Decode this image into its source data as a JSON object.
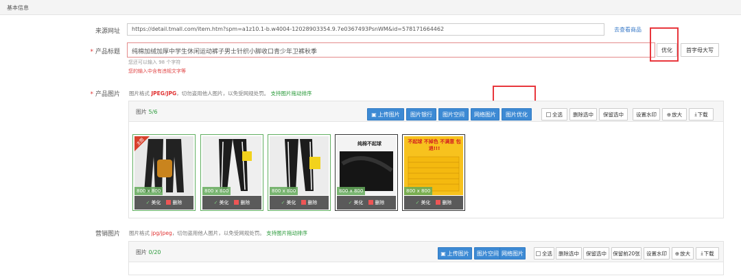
{
  "section": {
    "title": "基本信息"
  },
  "source": {
    "label": "来源网址",
    "url": "https://detail.tmall.com/item.htm?spm=a1z10.1-b.w4004-12028903354.9.7e0367493PsnWM&id=578171664462",
    "view_link": "去查看商品"
  },
  "product_title": {
    "label": "产品标题",
    "required": "*",
    "value": "纯棉加绒加厚中学生休闲运动裤子男士针织小脚收口青少年卫裤秋季",
    "hint_count": "您还可以输入 98 个字符",
    "hint_red": "您的输入中含有违规文字等",
    "optimize_button": "优化",
    "capitalize_button": "首字母大写"
  },
  "product_images": {
    "label": "产品图片",
    "required": "*",
    "format_prefix": "图片格式",
    "format_types": "JPEG/JPG",
    "format_suffix": "，切勿盗用他人图片，以免受网规处罚。",
    "format_sort": "支持图片拖动排序",
    "count_label": "图片",
    "count_value": "5/6",
    "buttons": {
      "upload": "上传图片",
      "bank": "图片银行",
      "space": "图片空间",
      "network": "网络图片",
      "optimize": "图片优化",
      "select_all": "全选",
      "delete_selected": "删除选中",
      "keep_selected": "保留选中",
      "watermark": "设置水印",
      "zoom": "放大",
      "download": "下载"
    },
    "thumbnails": [
      {
        "size": "800 x 800",
        "beautify": "美化",
        "delete": "删除",
        "badge": "主图",
        "promo": ""
      },
      {
        "size": "800 x 800",
        "beautify": "美化",
        "delete": "删除",
        "badge": "",
        "promo": ""
      },
      {
        "size": "800 x 800",
        "beautify": "美化",
        "delete": "删除",
        "badge": "",
        "promo": ""
      },
      {
        "size": "800 x 800",
        "beautify": "美化",
        "delete": "删除",
        "badge": "",
        "promo": "纯棉不起球"
      },
      {
        "size": "800 x 800",
        "beautify": "美化",
        "delete": "删除",
        "badge": "",
        "promo": "不起球 不掉色 不满意 包退!!!"
      }
    ]
  },
  "marketing_images": {
    "label": "营销图片",
    "format_prefix": "图片格式",
    "format_types": "jpg/jpeg",
    "format_suffix": "，切勿盗用他人图片，以免受网规处罚。",
    "format_sort": "支持图片拖动排序",
    "count_label": "图片",
    "count_value": "0/20",
    "buttons": {
      "upload": "上传图片",
      "space": "图片空间",
      "network": "网络图片",
      "select_all": "全选",
      "delete_selected": "删除选中",
      "keep_selected": "保留选中",
      "keep_first": "保留前20张",
      "watermark": "设置水印",
      "zoom": "放大",
      "download": "下载"
    }
  },
  "colors": {
    "primary_blue": "#3d8ad4",
    "highlight_red": "#e8353b",
    "green": "#2a9a3a"
  }
}
